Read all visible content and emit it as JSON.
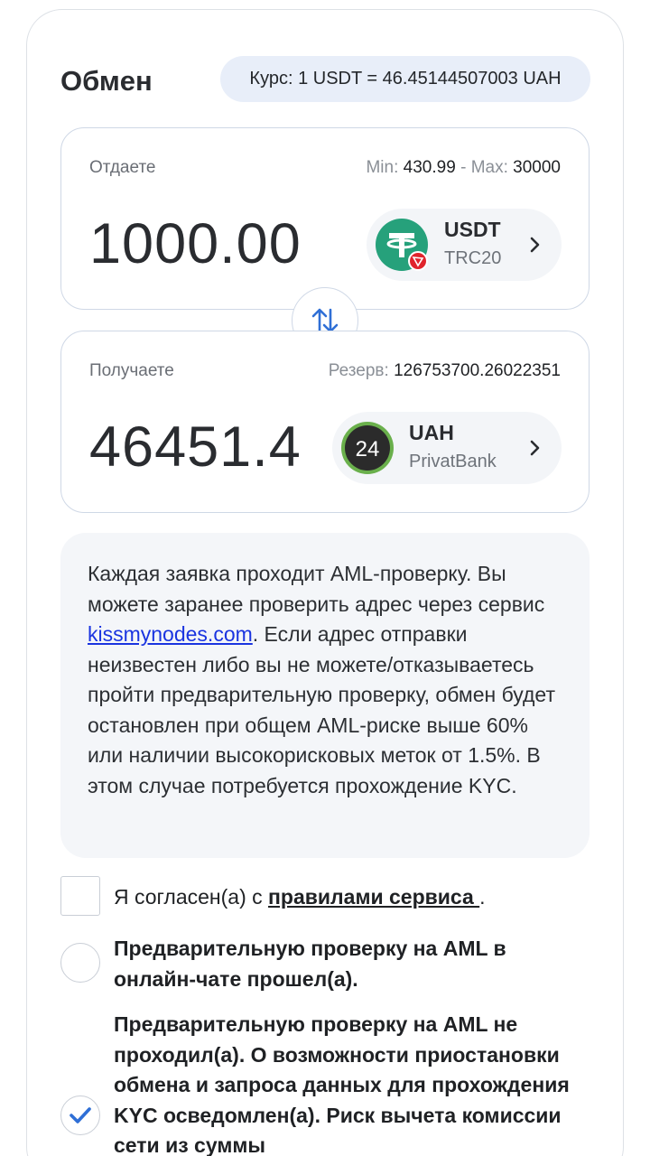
{
  "exchange": {
    "title": "Обмен",
    "rate": "Курс: 1 USDT = 46.45144507003 UAH"
  },
  "give": {
    "label": "Отдаете",
    "min_label": "Min:",
    "min_value": "430.99",
    "separator": "-",
    "max_label": "Max:",
    "max_value": "30000",
    "amount": "1000.00",
    "currency_code": "USDT",
    "currency_network": "TRC20",
    "icon": "tether-icon"
  },
  "get": {
    "label": "Получаете",
    "reserve_label": "Резерв:",
    "reserve_value": "126753700.26022351",
    "amount": "46451.4",
    "currency_code": "UAH",
    "currency_network": "PrivatBank",
    "icon_text": "24",
    "icon": "privatbank-icon"
  },
  "notice": {
    "text_before": "Каждая заявка проходит AML-проверку. Вы можете заранее проверить адрес через сервис ",
    "link": "kissmynodes.com",
    "text_after": ". Если адрес отправки неизвестен либо вы не можете/отказываетесь пройти предварительную проверку, обмен будет остановлен при общем AML-риске выше 60% или наличии высокорисковых меток от 1.5%. В этом случае потребуется прохождение KYC."
  },
  "agreement": {
    "text": "Я согласен(а) с ",
    "link": "правилами сервиса ",
    "suffix": ".",
    "checked": false
  },
  "aml_options": [
    {
      "text": "Предварительную проверку на AML в онлайн-чате прошел(а).",
      "selected": false
    },
    {
      "text": "Предварительную проверку на AML не проходил(а). О возможности приостановки обмена и запроса данных для прохождения KYC осведомлен(а). Риск вычета комиссии сети из суммы",
      "selected": true
    }
  ],
  "colors": {
    "accent": "#2f6fd6",
    "tether": "#26a17b",
    "tron": "#e0242c",
    "privat_ring": "#6ab04c",
    "link": "#1a34e0"
  }
}
